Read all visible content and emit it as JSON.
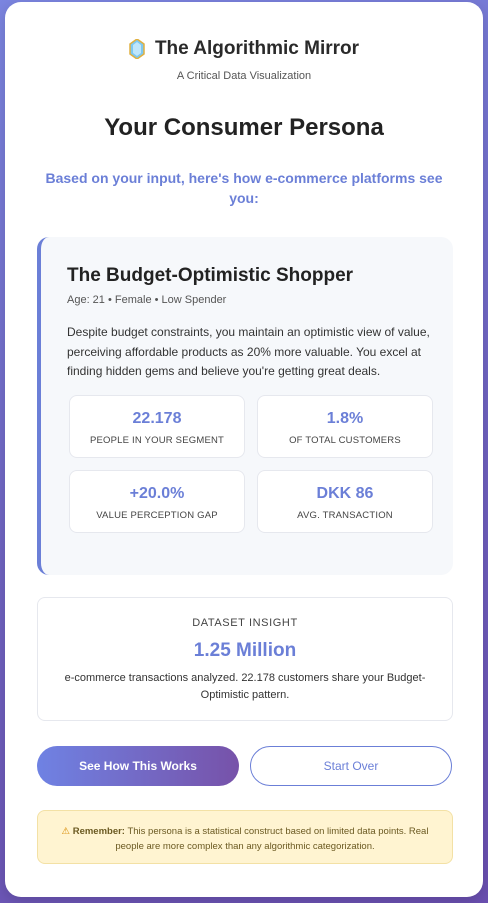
{
  "brand": {
    "title": "The Algorithmic Mirror",
    "subtitle": "A Critical Data Visualization",
    "icon": "crystal-gem-icon"
  },
  "page": {
    "title": "Your Consumer Persona",
    "intro": "Based on your input, here's how e-commerce platforms see you:"
  },
  "persona": {
    "name": "The Budget-Optimistic Shopper",
    "meta": "Age: 21 • Female • Low Spender",
    "description": "Despite budget constraints, you maintain an optimistic view of value, perceiving affordable products as 20% more valuable. You excel at finding hidden gems and believe you're getting great deals.",
    "stats": [
      {
        "value": "22.178",
        "label": "PEOPLE IN YOUR SEGMENT"
      },
      {
        "value": "1.8%",
        "label": "OF TOTAL CUSTOMERS"
      },
      {
        "value": "+20.0%",
        "label": "VALUE PERCEPTION GAP"
      },
      {
        "value": "DKK 86",
        "label": "AVG. TRANSACTION"
      }
    ]
  },
  "insight": {
    "label": "DATASET INSIGHT",
    "value": "1.25 Million",
    "text": "e-commerce transactions analyzed. 22.178 customers share your Budget-Optimistic pattern."
  },
  "actions": {
    "primary": "See How This Works",
    "secondary": "Start Over"
  },
  "notice": {
    "icon": "warning-icon",
    "icon_glyph": "⚠",
    "strong": "Remember:",
    "text": "This persona is a statistical construct based on limited data points. Real people are more complex than any algorithmic categorization."
  },
  "colors": {
    "accent": "#6b7fd7",
    "background_start": "#7b85e0",
    "background_end": "#6a4fb0",
    "notice_bg": "#fff4d1"
  }
}
